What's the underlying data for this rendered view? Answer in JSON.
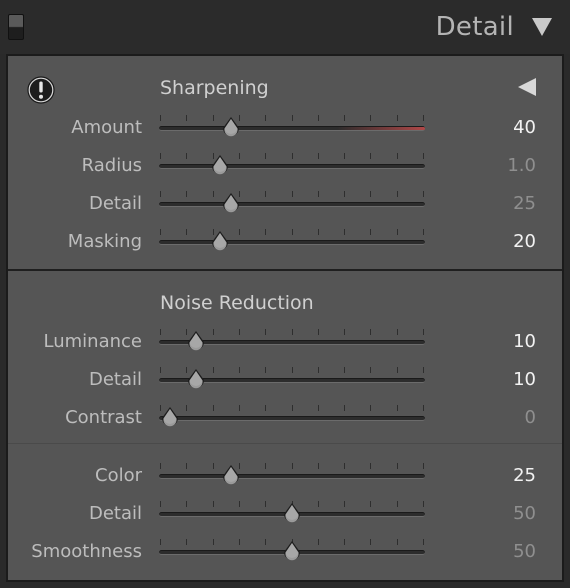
{
  "header": {
    "title": "Detail",
    "collapse_icon": "triangle-down-icon"
  },
  "sharpening": {
    "title": "Sharpening",
    "warning_icon": "exclamation-circle-icon",
    "collapse_icon": "triangle-left-icon",
    "sliders": [
      {
        "label": "Amount",
        "value": "40",
        "fraction": 0.27,
        "emphasis": "bright",
        "red_fill_from": 0.67
      },
      {
        "label": "Radius",
        "value": "1.0",
        "fraction": 0.23,
        "emphasis": "dim"
      },
      {
        "label": "Detail",
        "value": "25",
        "fraction": 0.27,
        "emphasis": "dim"
      },
      {
        "label": "Masking",
        "value": "20",
        "fraction": 0.23,
        "emphasis": "bright"
      }
    ]
  },
  "noise_reduction": {
    "title": "Noise Reduction",
    "luminance_group": [
      {
        "label": "Luminance",
        "value": "10",
        "fraction": 0.14,
        "emphasis": "bright"
      },
      {
        "label": "Detail",
        "value": "10",
        "fraction": 0.14,
        "emphasis": "bright"
      },
      {
        "label": "Contrast",
        "value": "0",
        "fraction": 0.04,
        "emphasis": "dim"
      }
    ],
    "color_group": [
      {
        "label": "Color",
        "value": "25",
        "fraction": 0.27,
        "emphasis": "bright"
      },
      {
        "label": "Detail",
        "value": "50",
        "fraction": 0.5,
        "emphasis": "dim"
      },
      {
        "label": "Smoothness",
        "value": "50",
        "fraction": 0.5,
        "emphasis": "dim"
      }
    ]
  },
  "colors": {
    "panel_bg": "#555555",
    "value_bright": "#f2f2f2",
    "value_dim": "#8f8f8f",
    "amount_track_tint": "#b04848"
  }
}
